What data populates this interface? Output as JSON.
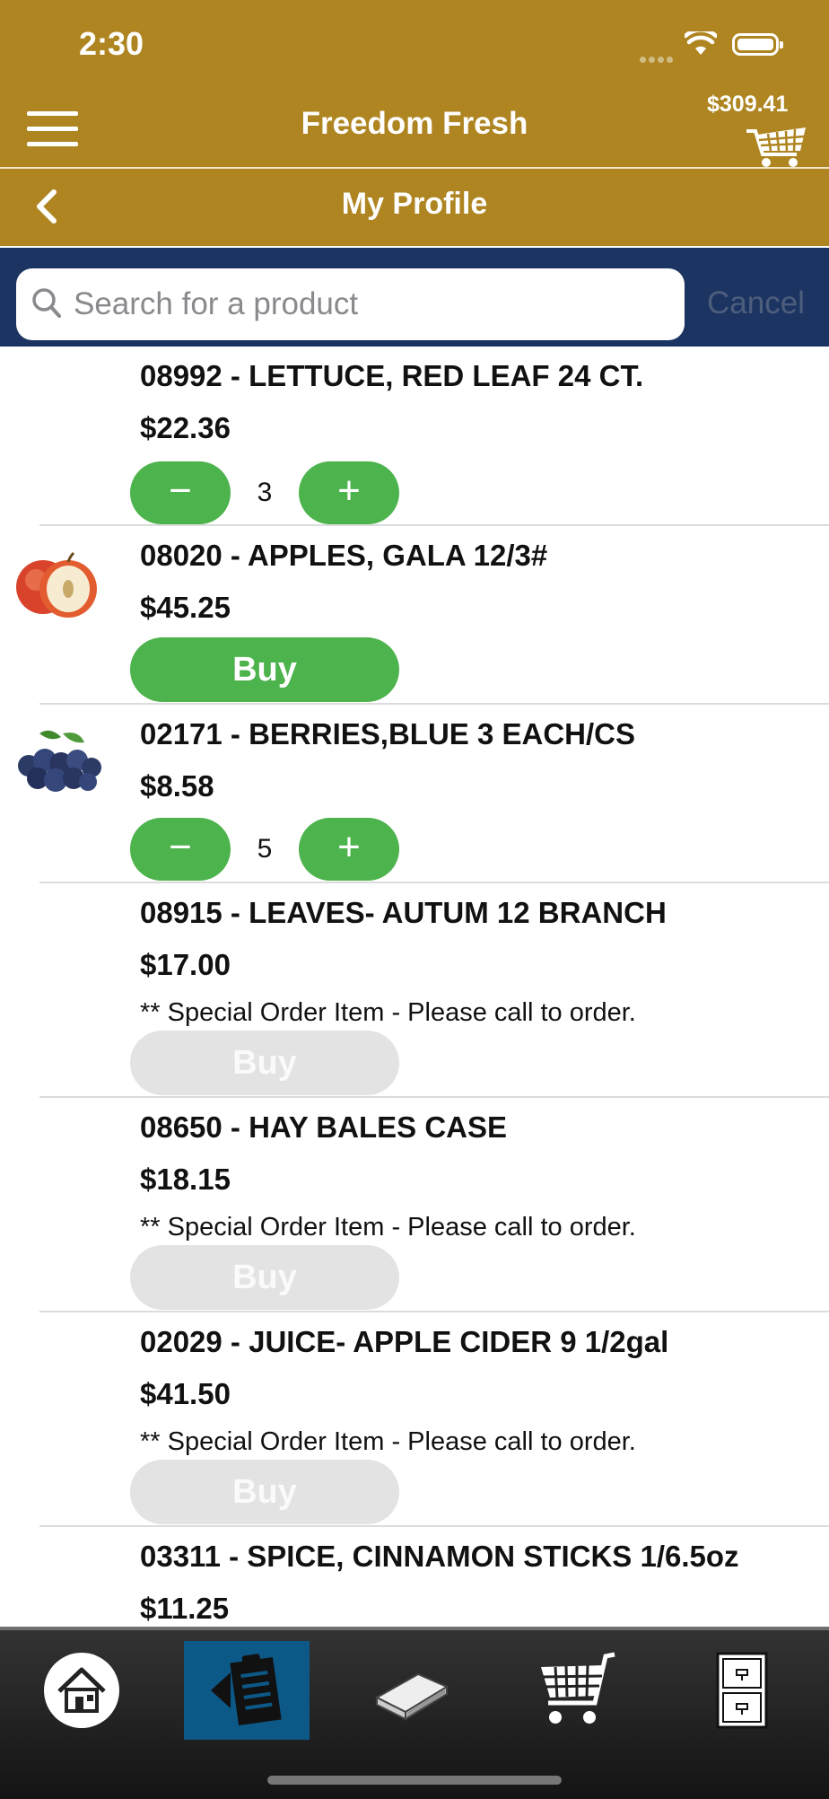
{
  "status_bar": {
    "time": "2:30"
  },
  "header": {
    "app_title": "Freedom Fresh",
    "cart_total": "$309.41",
    "page_title": "My Profile"
  },
  "search": {
    "placeholder": "Search for a product",
    "cancel_label": "Cancel"
  },
  "products": [
    {
      "name": "08992 - LETTUCE, RED LEAF 24 CT.",
      "price": "$22.36",
      "quantity": "3"
    },
    {
      "name": "08020 - APPLES, GALA 12/3#",
      "price": "$45.25",
      "buy_label": "Buy",
      "image": "apple-image"
    },
    {
      "name": "02171 - BERRIES,BLUE 3 EACH/CS",
      "price": "$8.58",
      "quantity": "5",
      "image": "blueberries-image"
    },
    {
      "name": "08915 - LEAVES- AUTUM 12 BRANCH",
      "price": "$17.00",
      "note": "** Special Order Item - Please call to order.",
      "buy_label": "Buy",
      "buy_enabled": false
    },
    {
      "name": "08650 - HAY BALES CASE",
      "price": "$18.15",
      "note": "** Special Order Item - Please call to order.",
      "buy_label": "Buy",
      "buy_enabled": false
    },
    {
      "name": "02029 - JUICE- APPLE CIDER 9 1/2gal",
      "price": "$41.50",
      "note": "** Special Order Item - Please call to order.",
      "buy_label": "Buy",
      "buy_enabled": false
    },
    {
      "name": "03311 - SPICE, CINNAMON STICKS 1/6.5oz",
      "price": "$11.25"
    }
  ],
  "tabs": [
    {
      "icon": "home-icon"
    },
    {
      "icon": "order-guide-icon",
      "active": true
    },
    {
      "icon": "catalog-book-icon"
    },
    {
      "icon": "cart-icon"
    },
    {
      "icon": "file-cabinet-icon"
    }
  ],
  "colors": {
    "header_gold": "#ae8521",
    "search_navy": "#1c3461",
    "button_green": "#4db34d",
    "button_disabled": "#e3e3e3",
    "active_tab_blue": "#0c5887"
  }
}
